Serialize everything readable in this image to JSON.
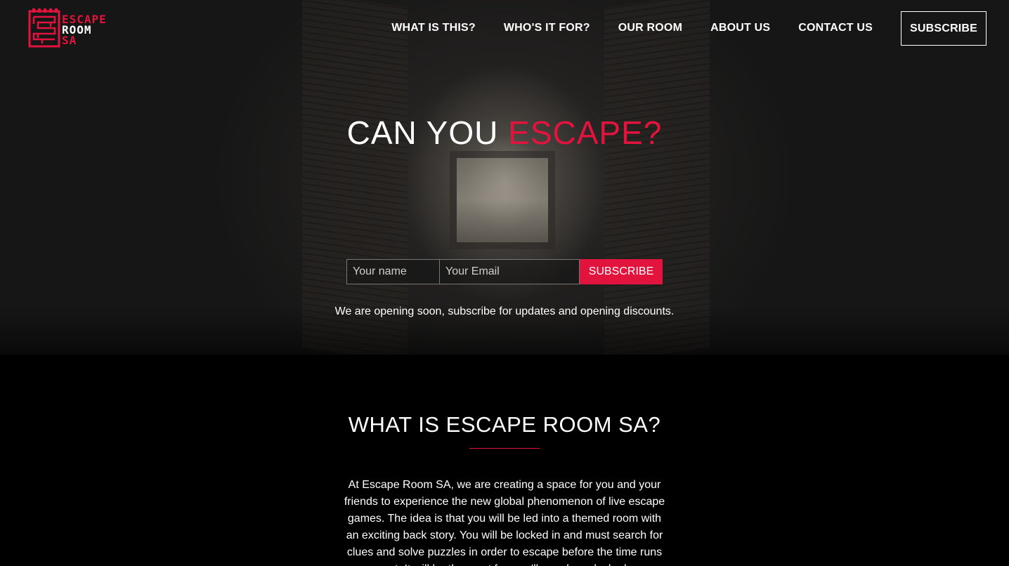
{
  "brand": {
    "line1": "ESCAPE",
    "line2": "ROOM",
    "line3": "SA"
  },
  "nav": {
    "items": [
      {
        "label": "WHAT IS THIS?"
      },
      {
        "label": "WHO'S IT FOR?"
      },
      {
        "label": "OUR ROOM"
      },
      {
        "label": "ABOUT US"
      },
      {
        "label": "CONTACT US"
      }
    ],
    "subscribe_label": "SUBSCRIBE"
  },
  "hero": {
    "headline_prefix": "CAN YOU ",
    "headline_accent": "ESCAPE?",
    "form": {
      "name_placeholder": "Your name",
      "email_placeholder": "Your Email",
      "submit_label": "SUBSCRIBE"
    },
    "notice": "We are opening soon, subscribe for updates and opening discounts."
  },
  "section": {
    "title": "WHAT IS ESCAPE ROOM SA?",
    "body": "At Escape Room SA, we are creating a space for you and your friends to experience the new global phenomenon of live escape games. The idea is that you will be led into a themed room with an exciting back story. You will be locked in and must search for clues and solve puzzles in order to escape before the time runs out. It will be the most fun you'll ever have locked"
  },
  "colors": {
    "accent": "#e2133c",
    "background": "#000000",
    "text": "#ffffff"
  }
}
